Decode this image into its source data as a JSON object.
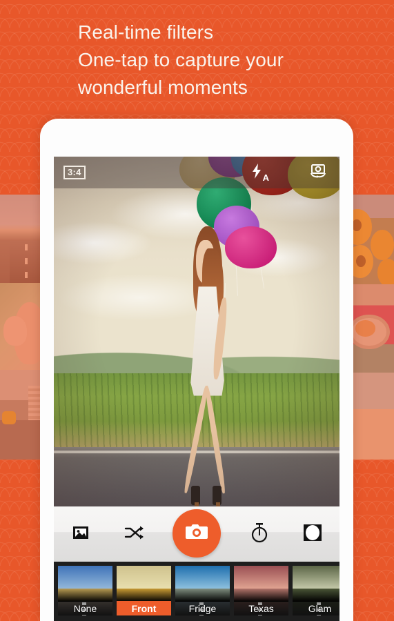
{
  "theme": {
    "brand_orange": "#E8572A",
    "accent_orange": "#EE5D2B",
    "headline_color": "#FAF3EC",
    "filter_strip_bg": "#1e1e1e"
  },
  "headline": {
    "line1": "Real-time filters",
    "line2": "One-tap to capture your",
    "line3": "wonderful moments"
  },
  "camera": {
    "topbar": {
      "aspect_ratio": "3:4",
      "aspect_ratio_name": "aspect-ratio-badge",
      "flash_icon": "flash-bolt-icon",
      "flash_mode": "A",
      "switch_camera_icon": "switch-camera-icon"
    },
    "viewfinder": {
      "scene_description": "Woman in white dress walking on a road holding balloons",
      "balloons": [
        {
          "color": "#b89a5e",
          "name": "balloon-tan"
        },
        {
          "color": "#7e2f86",
          "name": "balloon-purple"
        },
        {
          "color": "#2f6fb0",
          "name": "balloon-blue"
        },
        {
          "color": "#9e1f1c",
          "name": "balloon-red"
        },
        {
          "color": "#a89328",
          "name": "balloon-olive"
        },
        {
          "color": "#128a4e",
          "name": "balloon-green"
        },
        {
          "color": "#b05fd0",
          "name": "balloon-violet"
        },
        {
          "color": "#d3267f",
          "name": "balloon-magenta"
        }
      ]
    },
    "toolbar": [
      {
        "name": "gallery-button",
        "icon": "gallery-picture-icon",
        "label": "Gallery"
      },
      {
        "name": "shuffle-button",
        "icon": "shuffle-icon",
        "label": "Random filter"
      },
      {
        "name": "shutter-button",
        "icon": "camera-icon",
        "label": "Capture"
      },
      {
        "name": "timer-button",
        "icon": "stopwatch-timer-icon",
        "label": "Timer"
      },
      {
        "name": "blur-button",
        "icon": "vignette-circle-icon",
        "label": "Blur"
      }
    ],
    "filters": [
      {
        "label": "None",
        "selected": false,
        "sky": "#3f73b8",
        "sky2": "#93b7d9",
        "ground": "#b79a52",
        "road": "#4a443f"
      },
      {
        "label": "Front",
        "selected": true,
        "sky": "#cfc28d",
        "sky2": "#e8dfae",
        "ground": "#c79a33",
        "road": "#4e4026"
      },
      {
        "label": "Fridge",
        "selected": false,
        "sky": "#1f6fae",
        "sky2": "#8dc0de",
        "ground": "#7e8d7e",
        "road": "#3b4246"
      },
      {
        "label": "Texas",
        "selected": false,
        "sky": "#9a4f53",
        "sky2": "#e0a391",
        "ground": "#b2736a",
        "road": "#3d2c2a"
      },
      {
        "label": "Glam",
        "selected": false,
        "sky": "#5c6647",
        "sky2": "#c3c8a8",
        "ground": "#4a5536",
        "road": "#262a20"
      },
      {
        "label": "",
        "selected": false,
        "sky": "#2f6fb0",
        "sky2": "#8fb9dd",
        "ground": "#b48a3c",
        "road": "#413a34"
      }
    ]
  },
  "background_tiles": {
    "left": [
      {
        "name": "tile-open-road",
        "art": "art-road"
      },
      {
        "name": "tile-person-portrait",
        "art": "art-person"
      },
      {
        "name": "tile-street-scene",
        "art": "art-street"
      }
    ],
    "right": [
      {
        "name": "tile-sunflowers",
        "art": "art-sun"
      },
      {
        "name": "tile-pink-car",
        "art": "art-car"
      },
      {
        "name": "tile-beach",
        "art": "art-beach"
      }
    ]
  }
}
